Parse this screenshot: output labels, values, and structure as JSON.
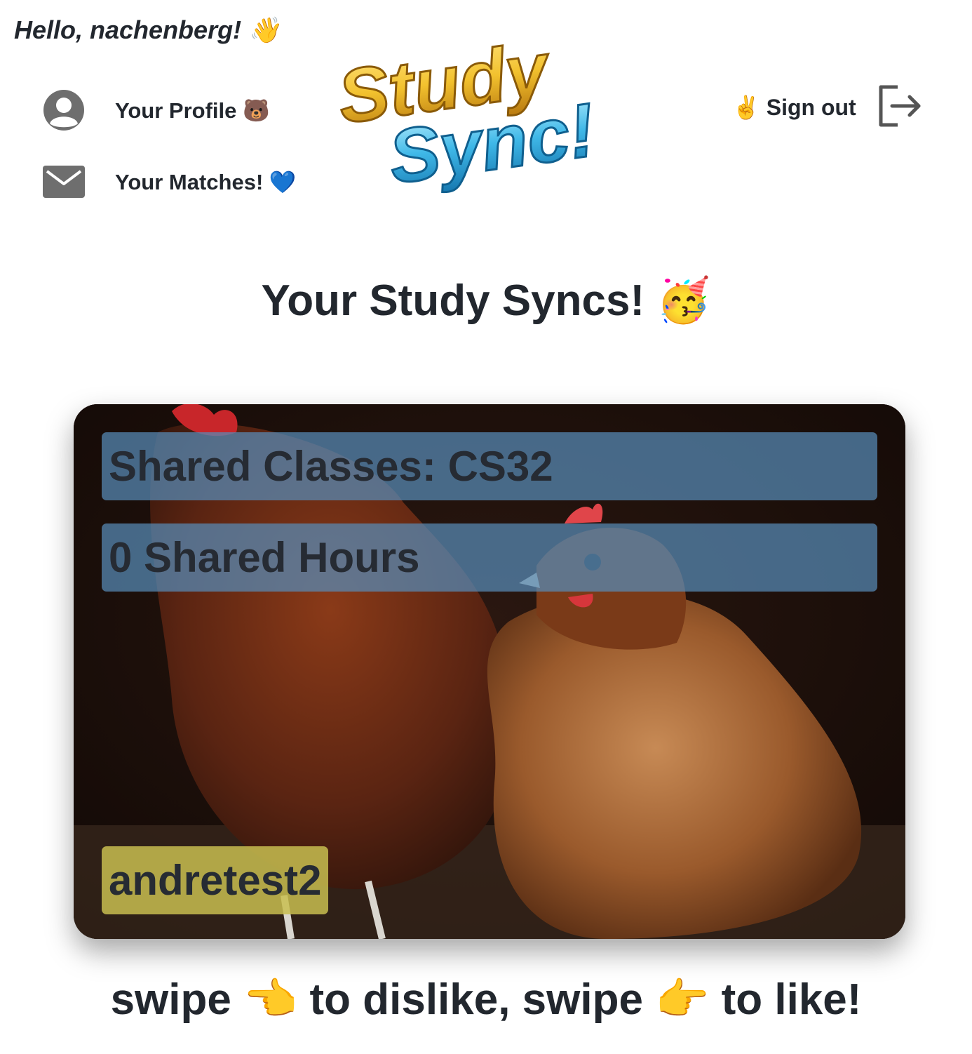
{
  "header": {
    "greeting": "Hello, nachenberg! 👋",
    "nav": [
      {
        "label": "Your Profile 🐻",
        "icon": "user-circle-icon"
      },
      {
        "label": "Your Matches! 💙",
        "icon": "envelope-icon"
      }
    ],
    "logo": {
      "line1": "Study",
      "line2": "Sync!"
    },
    "signout": {
      "label": "✌️ Sign out",
      "icon": "sign-out-icon"
    }
  },
  "main": {
    "title": "Your Study Syncs! 🥳",
    "card": {
      "shared_classes": "Shared Classes: CS32",
      "shared_hours": "0 Shared Hours",
      "username": "andretest2"
    },
    "instructions": "swipe 👈 to dislike, swipe 👉 to like!"
  },
  "colors": {
    "text": "#22272e",
    "info_bar": "#588cb9",
    "name_tag": "#c8be50",
    "logo_yellow": "#f2c12e",
    "logo_cyan": "#3fb8e8"
  }
}
